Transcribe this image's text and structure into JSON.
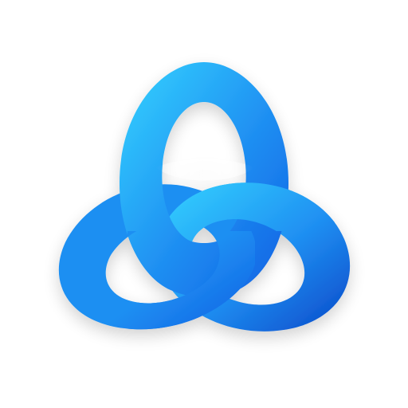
{
  "icon": {
    "name": "triquetra-knot-icon",
    "background": "#ffffff",
    "colors": {
      "light": "#35d4ff",
      "mid": "#1f8ff2",
      "deep": "#0f5fe3",
      "shadow": "#0a48c8"
    }
  }
}
